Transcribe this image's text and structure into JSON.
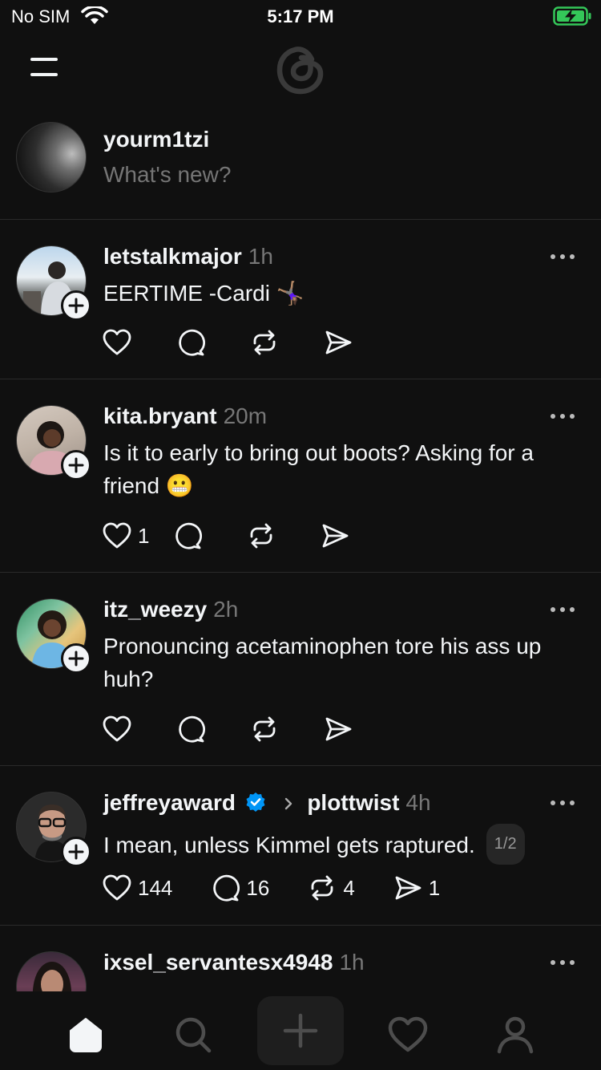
{
  "status_bar": {
    "carrier": "No SIM",
    "time": "5:17 PM"
  },
  "composer": {
    "username": "yourm1tzi",
    "placeholder": "What's new?"
  },
  "posts": [
    {
      "username": "letstalkmajor",
      "time": "1h",
      "text": "EERTIME -Cardi 🤸🏽‍♀️",
      "likes": "",
      "replies": "",
      "reposts": "",
      "shares": ""
    },
    {
      "username": "kita.bryant",
      "time": "20m",
      "text": "Is it to early to bring out boots? Asking for a friend 😬",
      "likes": "1",
      "replies": "",
      "reposts": "",
      "shares": ""
    },
    {
      "username": "itz_weezy",
      "time": "2h",
      "text": "Pronouncing acetaminophen tore his ass up huh?",
      "likes": "",
      "replies": "",
      "reposts": "",
      "shares": ""
    },
    {
      "username": "jeffreyaward",
      "reply_to": "plottwist",
      "time": "4h",
      "text": "I mean, unless Kimmel gets raptured.",
      "thread_index": "1/2",
      "likes": "144",
      "replies": "16",
      "reposts": "4",
      "shares": "1"
    },
    {
      "username": "ixsel_servantesx4948",
      "time": "1h"
    }
  ],
  "icons": {
    "menu": "hamburger-icon",
    "logo": "threads-logo",
    "follow": "plus-icon",
    "like": "heart-icon",
    "reply": "comment-icon",
    "repost": "repost-icon",
    "share": "send-icon",
    "more": "more-icon",
    "verified": "verified-badge-icon",
    "tabs": [
      "home-icon",
      "search-icon",
      "plus-icon",
      "heart-icon",
      "profile-icon"
    ]
  },
  "colors": {
    "background": "#101010",
    "text": "#f3f5f7",
    "muted": "#777777",
    "verified": "#0095f6"
  }
}
